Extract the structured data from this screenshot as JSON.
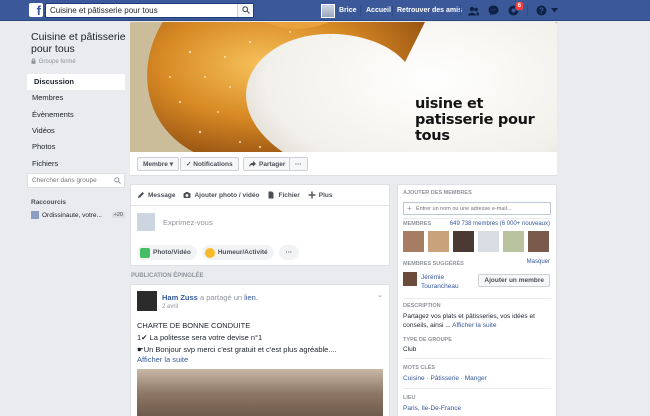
{
  "topbar": {
    "logo": "f",
    "search_value": "Cuisine et pâtisserie pour tous",
    "user_name": "Brice",
    "home": "Accueil",
    "find_friends": "Retrouver des amis",
    "notif_count": "6"
  },
  "group": {
    "name": "Cuisine et pâtisserie pour tous",
    "type": "Groupe fermé"
  },
  "leftnav": {
    "items": [
      "Discussion",
      "Membres",
      "Évènements",
      "Vidéos",
      "Photos",
      "Fichiers"
    ],
    "search_placeholder": "Chercher dans groupe",
    "shortcuts_title": "Raccourcis",
    "shortcut_label": "Ordissinaute, votre...",
    "shortcut_count": "+20"
  },
  "cover": {
    "text": "uisine et patisserie pour tous"
  },
  "actionbar": {
    "member": "Membre ▾",
    "notifications": "✓ Notifications",
    "share": "Partager",
    "more": "···"
  },
  "composer": {
    "tab_message": "Message",
    "tab_photo": "Ajouter photo / vidéo",
    "tab_file": "Fichier",
    "tab_more": "Plus",
    "placeholder": "Exprimez-vous",
    "btn_photo": "Photo/Vidéo",
    "btn_mood": "Humeur/Activité",
    "btn_more": "···"
  },
  "pinned": {
    "title": "PUBLICATION ÉPINGLÉE",
    "author": "Ham Zuss",
    "shared_text": "a partagé un",
    "shared_link": "lien.",
    "date": "2 avril",
    "line1": "CHARTE DE BONNE CONDUITE",
    "line2": "1✔ La politesse sera votre devise n°1",
    "line3": "☛Un Bonjour svp merci c'est gratuit et c'est plus agréable....",
    "see_more": "Afficher la suite"
  },
  "right": {
    "add_title": "AJOUTER DES MEMBRES",
    "add_placeholder": "Entrer un nom ou une adresse e-mail...",
    "members_title": "MEMBRES",
    "members_count": "649 738 membres (6 000+ nouveaux)",
    "hide": "Masquer",
    "suggested_title": "MEMBRES SUGGÉRÉS",
    "suggested_name_1": "Jérémie",
    "suggested_name_2": "Tourancheau",
    "add_member_btn": "Ajouter un membre",
    "desc_title": "DESCRIPTION",
    "desc_text": "Partagez vos plats et pâtisseries, vos idées et conseils, ainsi ...",
    "desc_more": "Afficher la suite",
    "type_title": "TYPE DE GROUPE",
    "type_value": "Club",
    "tags_title": "MOTS CLÉS",
    "tags_value": "Cuisine · Pâtisserie · Manger",
    "place_title": "LIEU",
    "place_value": "Paris, Ile-De-France"
  }
}
